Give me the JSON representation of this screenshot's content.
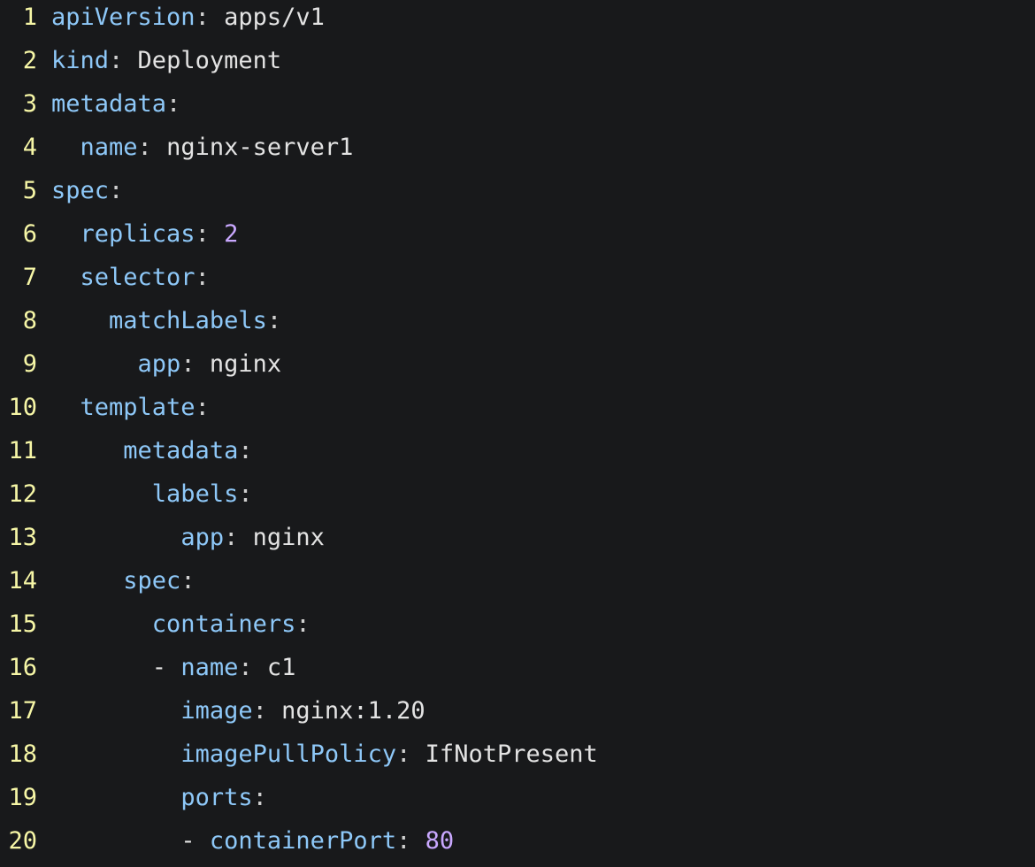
{
  "editor": {
    "colors": {
      "background": "#18191b",
      "line_number": "#f6f6a6",
      "key": "#8ec8f8",
      "string_value": "#e3e3e3",
      "number_value": "#c9a8ff"
    },
    "lines": [
      {
        "number": "1",
        "indent": "",
        "dash": "",
        "key": "apiVersion",
        "sep": ":",
        "value": " apps/v1",
        "value_type": "string"
      },
      {
        "number": "2",
        "indent": "",
        "dash": "",
        "key": "kind",
        "sep": ":",
        "value": " Deployment",
        "value_type": "string"
      },
      {
        "number": "3",
        "indent": "",
        "dash": "",
        "key": "metadata",
        "sep": ":",
        "value": "",
        "value_type": "none"
      },
      {
        "number": "4",
        "indent": "  ",
        "dash": "",
        "key": "name",
        "sep": ":",
        "value": " nginx-server1",
        "value_type": "string"
      },
      {
        "number": "5",
        "indent": "",
        "dash": "",
        "key": "spec",
        "sep": ":",
        "value": "",
        "value_type": "none"
      },
      {
        "number": "6",
        "indent": "  ",
        "dash": "",
        "key": "replicas",
        "sep": ":",
        "value": " 2",
        "value_type": "number"
      },
      {
        "number": "7",
        "indent": "  ",
        "dash": "",
        "key": "selector",
        "sep": ":",
        "value": "",
        "value_type": "none"
      },
      {
        "number": "8",
        "indent": "    ",
        "dash": "",
        "key": "matchLabels",
        "sep": ":",
        "value": "",
        "value_type": "none"
      },
      {
        "number": "9",
        "indent": "      ",
        "dash": "",
        "key": "app",
        "sep": ":",
        "value": " nginx",
        "value_type": "string"
      },
      {
        "number": "10",
        "indent": "  ",
        "dash": "",
        "key": "template",
        "sep": ":",
        "value": "",
        "value_type": "none"
      },
      {
        "number": "11",
        "indent": "     ",
        "dash": "",
        "key": "metadata",
        "sep": ":",
        "value": "",
        "value_type": "none"
      },
      {
        "number": "12",
        "indent": "       ",
        "dash": "",
        "key": "labels",
        "sep": ":",
        "value": "",
        "value_type": "none"
      },
      {
        "number": "13",
        "indent": "         ",
        "dash": "",
        "key": "app",
        "sep": ":",
        "value": " nginx",
        "value_type": "string"
      },
      {
        "number": "14",
        "indent": "     ",
        "dash": "",
        "key": "spec",
        "sep": ":",
        "value": "",
        "value_type": "none"
      },
      {
        "number": "15",
        "indent": "       ",
        "dash": "",
        "key": "containers",
        "sep": ":",
        "value": "",
        "value_type": "none"
      },
      {
        "number": "16",
        "indent": "       ",
        "dash": "- ",
        "key": "name",
        "sep": ":",
        "value": " c1",
        "value_type": "string"
      },
      {
        "number": "17",
        "indent": "         ",
        "dash": "",
        "key": "image",
        "sep": ":",
        "value": " nginx:1.20",
        "value_type": "string"
      },
      {
        "number": "18",
        "indent": "         ",
        "dash": "",
        "key": "imagePullPolicy",
        "sep": ":",
        "value": " IfNotPresent",
        "value_type": "string"
      },
      {
        "number": "19",
        "indent": "         ",
        "dash": "",
        "key": "ports",
        "sep": ":",
        "value": "",
        "value_type": "none"
      },
      {
        "number": "20",
        "indent": "         ",
        "dash": "- ",
        "key": "containerPort",
        "sep": ":",
        "value": " 80",
        "value_type": "number"
      }
    ]
  }
}
